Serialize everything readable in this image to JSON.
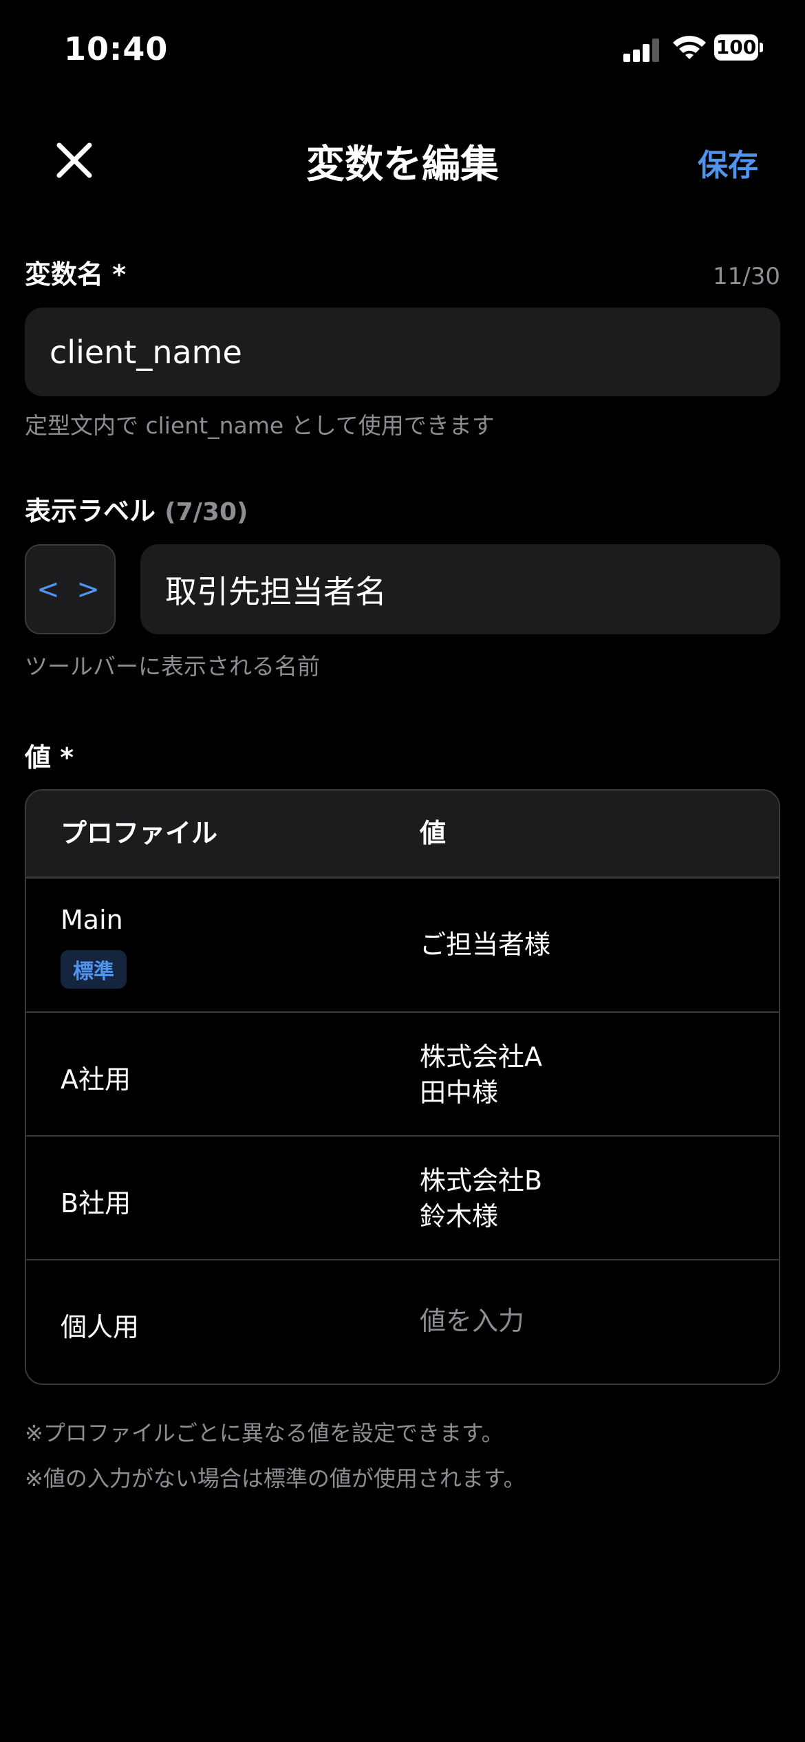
{
  "status_bar": {
    "time": "10:40",
    "battery": "100"
  },
  "nav": {
    "title": "変数を編集",
    "save_label": "保存"
  },
  "variable_name": {
    "label": "変数名 *",
    "counter": "11/30",
    "value": "client_name",
    "hint": "定型文内で client_name として使用できます"
  },
  "display_label": {
    "label": "表示ラベル",
    "counter": "(7/30)",
    "icon_text": "< >",
    "value": "取引先担当者名",
    "hint": "ツールバーに表示される名前"
  },
  "values": {
    "label": "値 *",
    "headers": {
      "profile": "プロファイル",
      "value": "値"
    },
    "rows": [
      {
        "profile": "Main",
        "badge": "標準",
        "value": "ご担当者様"
      },
      {
        "profile": "A社用",
        "value": "株式会社A\n田中様"
      },
      {
        "profile": "B社用",
        "value": "株式会社B\n鈴木様"
      },
      {
        "profile": "個人用",
        "placeholder": "値を入力"
      }
    ]
  },
  "notes": [
    "※プロファイルごとに異なる値を設定できます。",
    "※値の入力がない場合は標準の値が使用されます。"
  ],
  "colors": {
    "accent": "#4f95f0",
    "field_bg": "#1c1c1e",
    "border": "#3a3a3c",
    "muted": "#8d8d93"
  }
}
